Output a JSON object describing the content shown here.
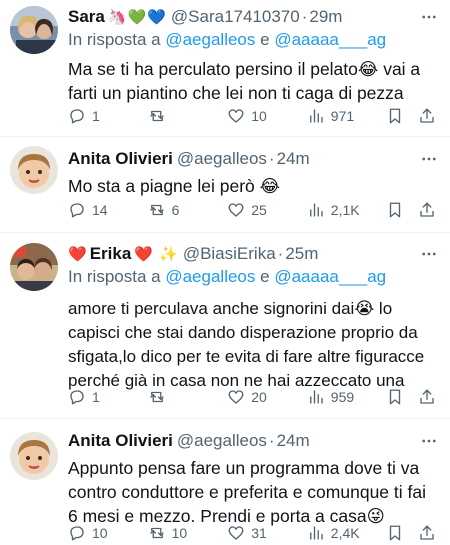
{
  "tweets": [
    {
      "name": "Sara",
      "name_emoji": "🦄💚💙",
      "handle": "@Sara17410370",
      "time": "29m",
      "reply_prefix": "In risposta a",
      "reply_users": [
        "@aegalleos",
        "@aaaaa___ag"
      ],
      "reply_joiner": "e",
      "text_lines": [
        "Ma se ti ha perculato persino il pelato😂 vai a",
        "farti un piantino che lei non ti caga di pezza"
      ],
      "replies": "1",
      "retweets": "",
      "likes": "10",
      "views": "971"
    },
    {
      "name": "Anita Olivieri",
      "name_emoji": "",
      "handle": "@aegalleos",
      "time": "24m",
      "text_lines": [
        "Mo sta a piagne lei però 😂"
      ],
      "replies": "14",
      "retweets": "6",
      "likes": "25",
      "views": "2,1K"
    },
    {
      "name_prefix_emoji": "❤️",
      "name": "Erika",
      "name_emoji": "❤️ ✨",
      "handle": "@BiasiErika",
      "time": "25m",
      "reply_prefix": "In risposta a",
      "reply_users": [
        "@aegalleos",
        "@aaaaa___ag"
      ],
      "reply_joiner": "e",
      "text_lines": [
        "amore ti perculava anche signorini dai😭 lo",
        "capisci che stai dando disperazione proprio da",
        "sfigata,lo dico per te evita di fare altre figuracce",
        "perché già in casa non ne hai azzeccato una"
      ],
      "replies": "1",
      "retweets": "",
      "likes": "20",
      "views": "959"
    },
    {
      "name": "Anita Olivieri",
      "name_emoji": "",
      "handle": "@aegalleos",
      "time": "24m",
      "text_lines": [
        "Appunto pensa fare un programma dove ti va",
        "contro conduttore e preferita e comunque ti fai",
        "6 mesi e mezzo. Prendi e porta a casa😜"
      ],
      "replies": "10",
      "retweets": "10",
      "likes": "31",
      "views": "2,4K"
    }
  ],
  "colors": {
    "text": "#0f1419",
    "secondary": "#536471",
    "link": "#1d9bf0",
    "divider": "#eff3f4"
  },
  "icons": [
    "reply-icon",
    "retweet-icon",
    "like-icon",
    "views-icon",
    "bookmark-icon",
    "share-icon",
    "more-icon"
  ]
}
